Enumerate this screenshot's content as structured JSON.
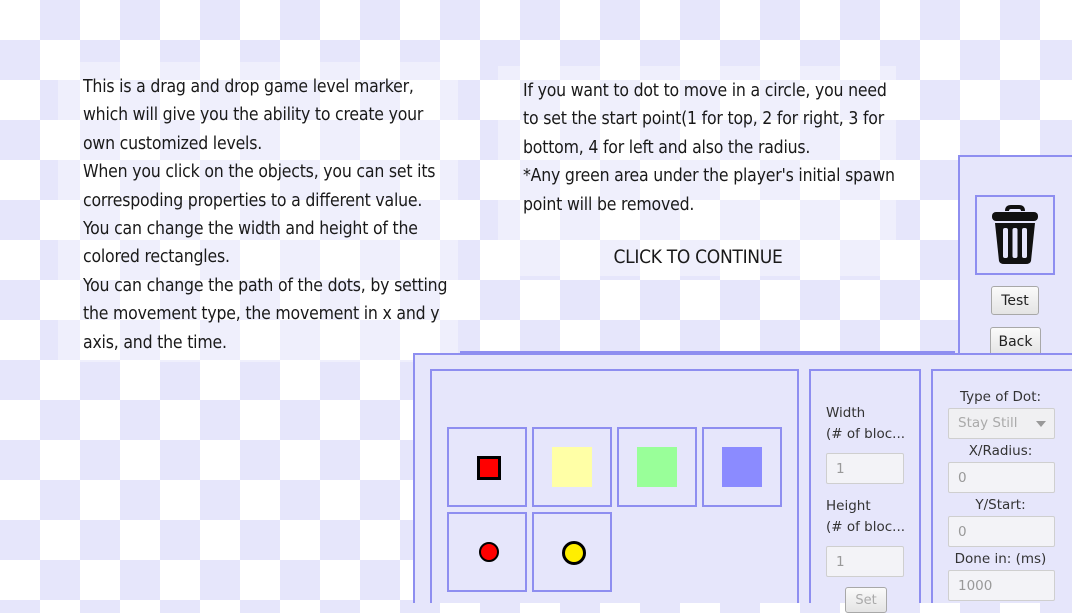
{
  "instructions": {
    "left": "This is a drag and drop game level marker, which will give you the ability to create your own customized levels.\nWhen you click on the objects, you can set its correspoding properties to a different value.\nYou can change the width and height of the colored rectangles.\nYou can change the path of the dots, by setting the movement type, the movement in x and y axis, and the time.",
    "right": "If you want to dot to move in a circle, you need to set the start point(1 for top, 2 for right, 3 for bottom, 4 for left and also the radius.\n*Any green area under the player's initial spawn point will be removed.",
    "continue": "CLICK TO CONTINUE"
  },
  "side_panel": {
    "trash_icon": "trash-can-icon",
    "test_label": "Test",
    "back_label": "Back"
  },
  "palette": {
    "items": [
      {
        "kind": "square",
        "color": "#ff0000",
        "outline": "#000000"
      },
      {
        "kind": "square",
        "color": "#ffffa6"
      },
      {
        "kind": "square",
        "color": "#99ff99"
      },
      {
        "kind": "square",
        "color": "#8b8bff"
      },
      {
        "kind": "dot",
        "color": "#ff0000"
      },
      {
        "kind": "dot",
        "color": "#ffee00"
      }
    ]
  },
  "size_panel": {
    "width_label": "Width\n(# of bloc...",
    "width_value": "1",
    "height_label": "Height\n(# of bloc...",
    "height_value": "1",
    "set_label": "Set"
  },
  "dot_panel": {
    "type_label": "Type of Dot:",
    "type_value": "Stay Still",
    "x_label": "X/Radius:",
    "x_value": "0",
    "y_label": "Y/Start:",
    "y_value": "0",
    "done_label": "Done in: (ms)",
    "done_value": "1000"
  },
  "colors": {
    "panel_border": "#8e8ef0",
    "panel_bg": "#e6e6fb",
    "checker": "#e6e6fb"
  }
}
